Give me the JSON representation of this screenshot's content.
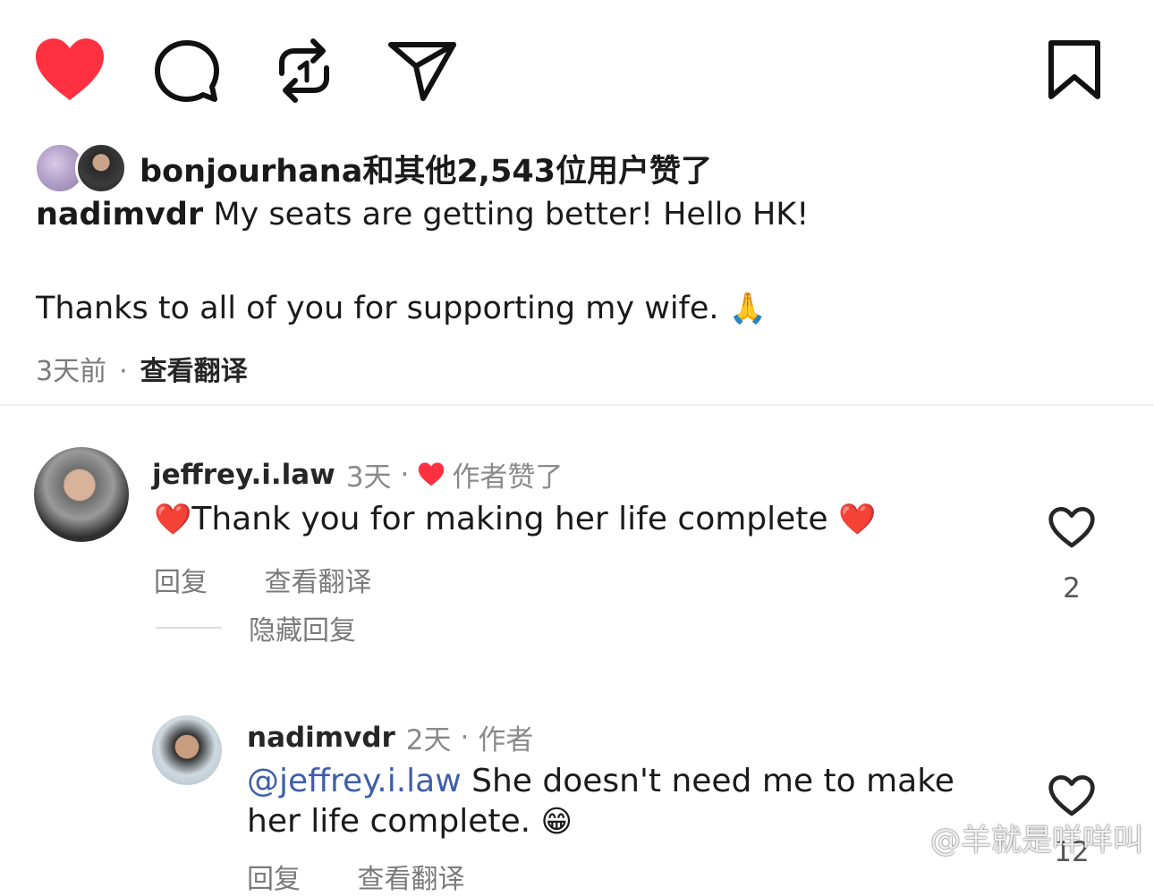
{
  "action_bar": {
    "like_icon": "heart-filled-icon",
    "comment_icon": "comment-bubble-icon",
    "repost_icon": "repost-icon",
    "share_icon": "send-icon",
    "save_icon": "bookmark-icon",
    "like_color": "#ff3040"
  },
  "likes": {
    "user": "bonjourhana",
    "rest": "和其他2,543位用户赞了"
  },
  "caption": {
    "user": "nadimvdr",
    "line1": "My seats are getting better! Hello HK!",
    "line2": "Thanks to all of you for supporting my wife.",
    "emoji": "🙏"
  },
  "post_meta": {
    "time": "3天前",
    "separator": "·",
    "translate": "查看翻译"
  },
  "comments": [
    {
      "user": "jeffrey.i.law",
      "time": "3天",
      "separator": "·",
      "author_liked": "作者赞了",
      "emoji_left": "❤️",
      "text": "Thank you for making her life complete",
      "emoji_right": "❤️",
      "reply": "回复",
      "translate": "查看翻译",
      "like_count": "2",
      "hide_replies": "隐藏回复"
    },
    {
      "user": "nadimvdr",
      "time": "2天",
      "separator": "·",
      "author_badge": "作者",
      "mention": "@jeffrey.i.law",
      "text_line1": " She doesn't need me to make",
      "text_line2": "her life complete.",
      "emoji": "😁",
      "reply": "回复",
      "translate": "查看翻译",
      "like_count": "12"
    }
  ],
  "watermark": "@羊就是咩咩叫"
}
